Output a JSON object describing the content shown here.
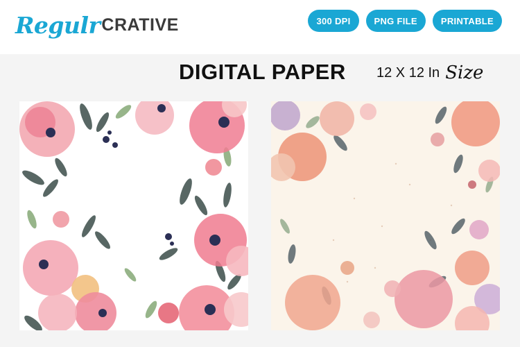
{
  "brand": {
    "logo_script": "Regulr",
    "logo_block": "CRATIVE"
  },
  "badges": [
    "300 DPI",
    "PNG FILE",
    "PRINTABLE"
  ],
  "title": "DIGITAL PAPER",
  "size": {
    "text": "12 X 12 In",
    "script": "Size"
  },
  "colors": {
    "accent": "#1aa7d4",
    "logo_dark": "#3a3a3a"
  },
  "papers": [
    {
      "id": "watercolor-floral-white",
      "background": "#ffffff"
    },
    {
      "id": "watercolor-floral-cream",
      "background": "#fbf4ea"
    }
  ]
}
